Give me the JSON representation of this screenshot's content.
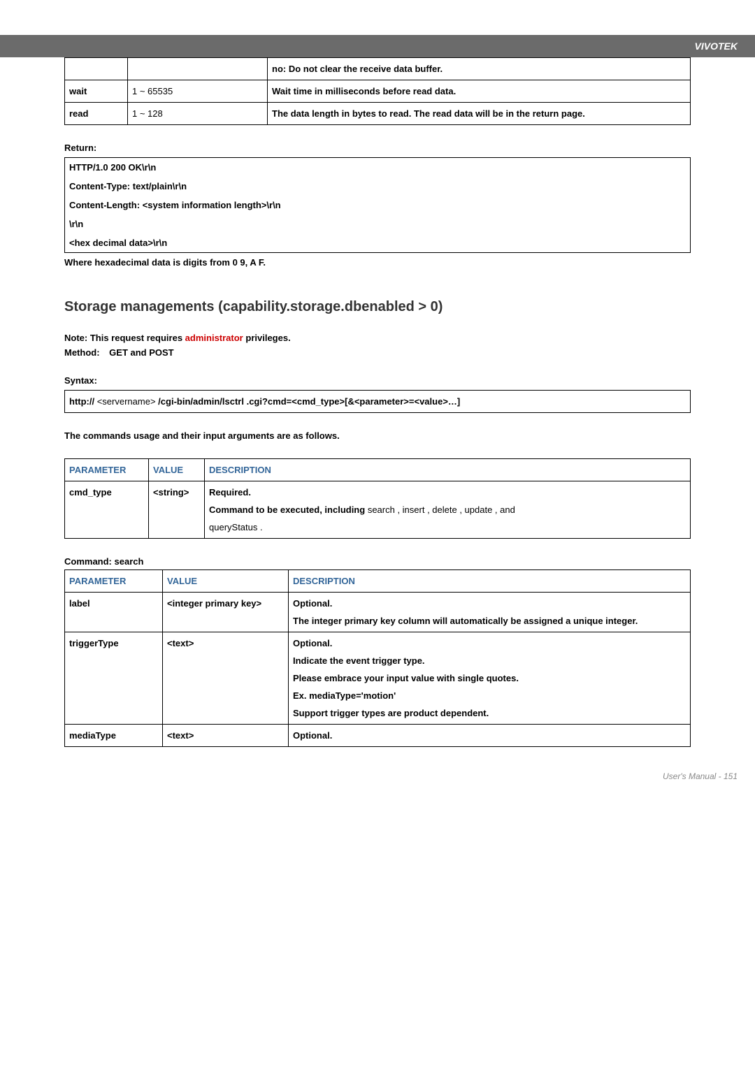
{
  "header": {
    "brand": "VIVOTEK"
  },
  "table1": {
    "rows": [
      {
        "param": "",
        "value": "",
        "desc": "no: Do not clear the receive data buffer."
      },
      {
        "param": "wait",
        "value": "1 ~ 65535",
        "desc": "Wait time in milliseconds before read data."
      },
      {
        "param": "read",
        "value": "1 ~ 128",
        "desc": "The data length in bytes to read. The read data will be in the return page."
      }
    ]
  },
  "return_section": {
    "label": "Return:",
    "lines": [
      "HTTP/1.0 200 OK\\r\\n",
      "Content-Type: text/plain\\r\\n",
      "Content-Length: <system information length>\\r\\n",
      "\\r\\n",
      "<hex decimal data>\\r\\n"
    ],
    "note": "Where hexadecimal data is digits from 0  9, A  F."
  },
  "section_marker": "Storage managements (capability.storage.dbenabled > 0)",
  "notes": {
    "note_prefix": "Note:",
    "note_body_prefix": "This request requires ",
    "note_admin": "administrator",
    "note_body_suffix": " privileges.",
    "method_prefix": "Method:",
    "method": "GET and POST"
  },
  "syntax": {
    "label": "Syntax:",
    "line": "http://<servername>/cgi-bin/admin/lsctrl.cgi?cmd=<cmd_type>[&<parameter>=<value>…]",
    "line_prefix": "http://",
    "line_server": "<servername>",
    "line_path": "/cgi-bin/admin/lsctrl",
    "line_suffix": ".cgi?cmd=<cmd_type>[&<parameter>=<value>…]"
  },
  "commands_intro": "The commands usage and their input arguments are as follows.",
  "table2": {
    "headers": {
      "p": "PARAMETER",
      "v": "VALUE",
      "d": "DESCRIPTION"
    },
    "row": {
      "param": "cmd_type",
      "value": "<string>",
      "desc_req": "Required.",
      "desc_body_1": "Command to be executed, including ",
      "desc_body_2": "search , insert , delete , update , and ",
      "desc_body_3": "queryStatus    ."
    }
  },
  "command_label": "Command: ",
  "command_name": "search",
  "table3": {
    "headers": {
      "p": "PARAMETER",
      "v": "VALUE",
      "d": "DESCRIPTION"
    },
    "rows": [
      {
        "param": "label",
        "value": "<integer primary key>",
        "desc": [
          "Optional.",
          "The integer primary key column will automatically be assigned a unique integer."
        ]
      },
      {
        "param": "triggerType",
        "value": "<text>",
        "desc": [
          "Optional.",
          "Indicate the event trigger type.",
          "Please embrace your input value with single quotes.",
          "Ex. mediaType='motion'",
          "Support trigger types are product dependent."
        ]
      },
      {
        "param": "mediaType",
        "value": "<text>",
        "desc": [
          "Optional."
        ]
      }
    ]
  },
  "footer": {
    "text": "User's Manual - 151"
  }
}
